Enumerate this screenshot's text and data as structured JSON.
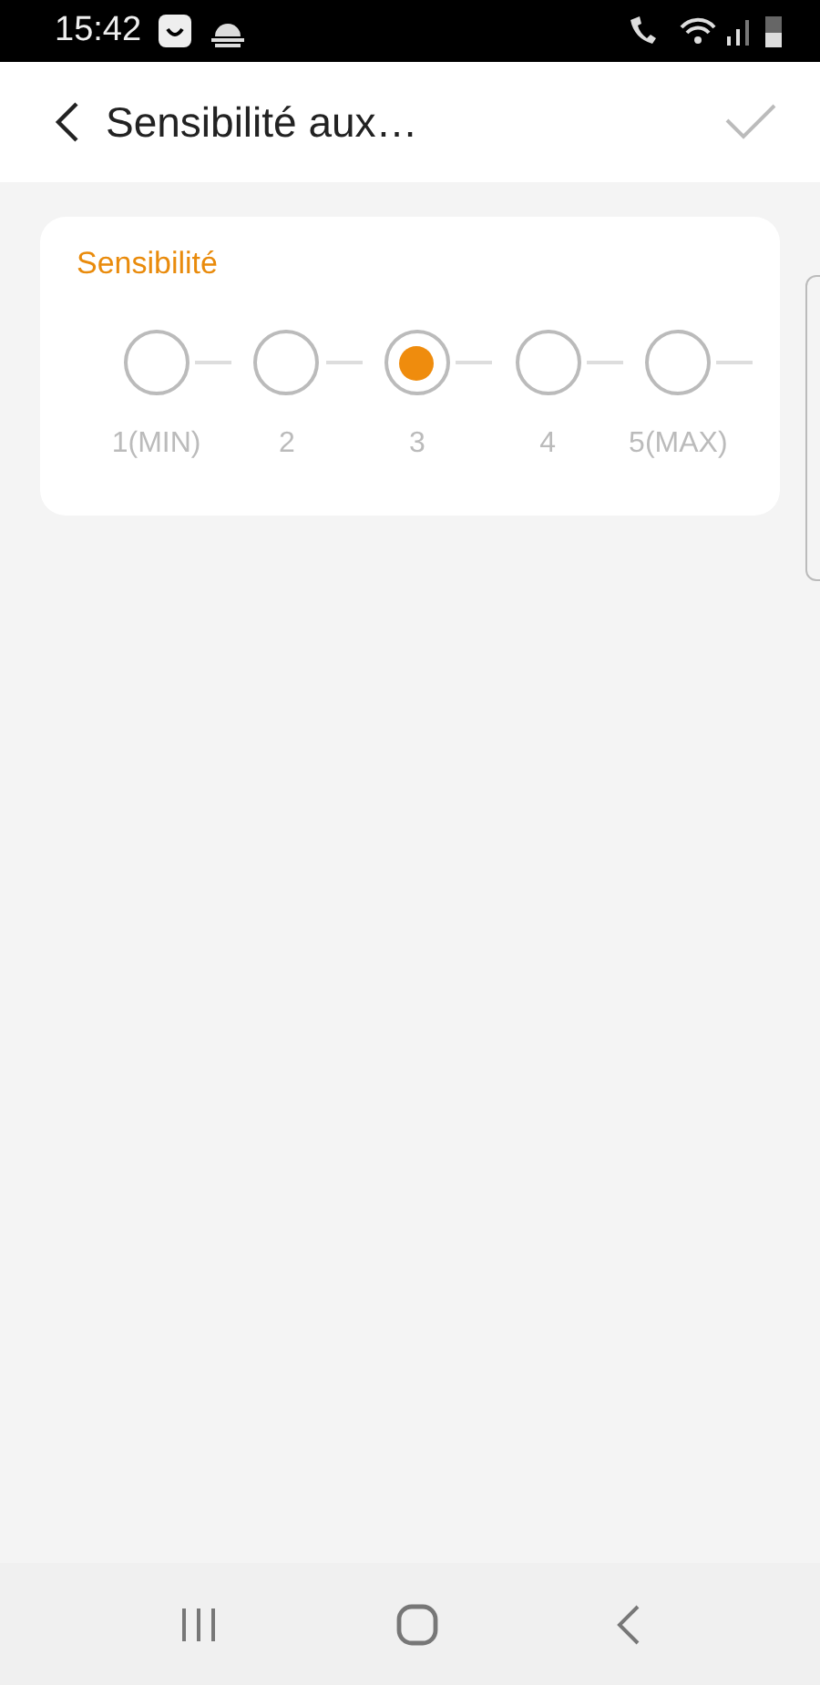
{
  "status_bar": {
    "time": "15:42"
  },
  "header": {
    "title": "Sensibilité aux…"
  },
  "card": {
    "title": "Sensibilité",
    "options": [
      {
        "label": "1(MIN)",
        "selected": false
      },
      {
        "label": "2",
        "selected": false
      },
      {
        "label": "3",
        "selected": true
      },
      {
        "label": "4",
        "selected": false
      },
      {
        "label": "5(MAX)",
        "selected": false
      }
    ]
  }
}
